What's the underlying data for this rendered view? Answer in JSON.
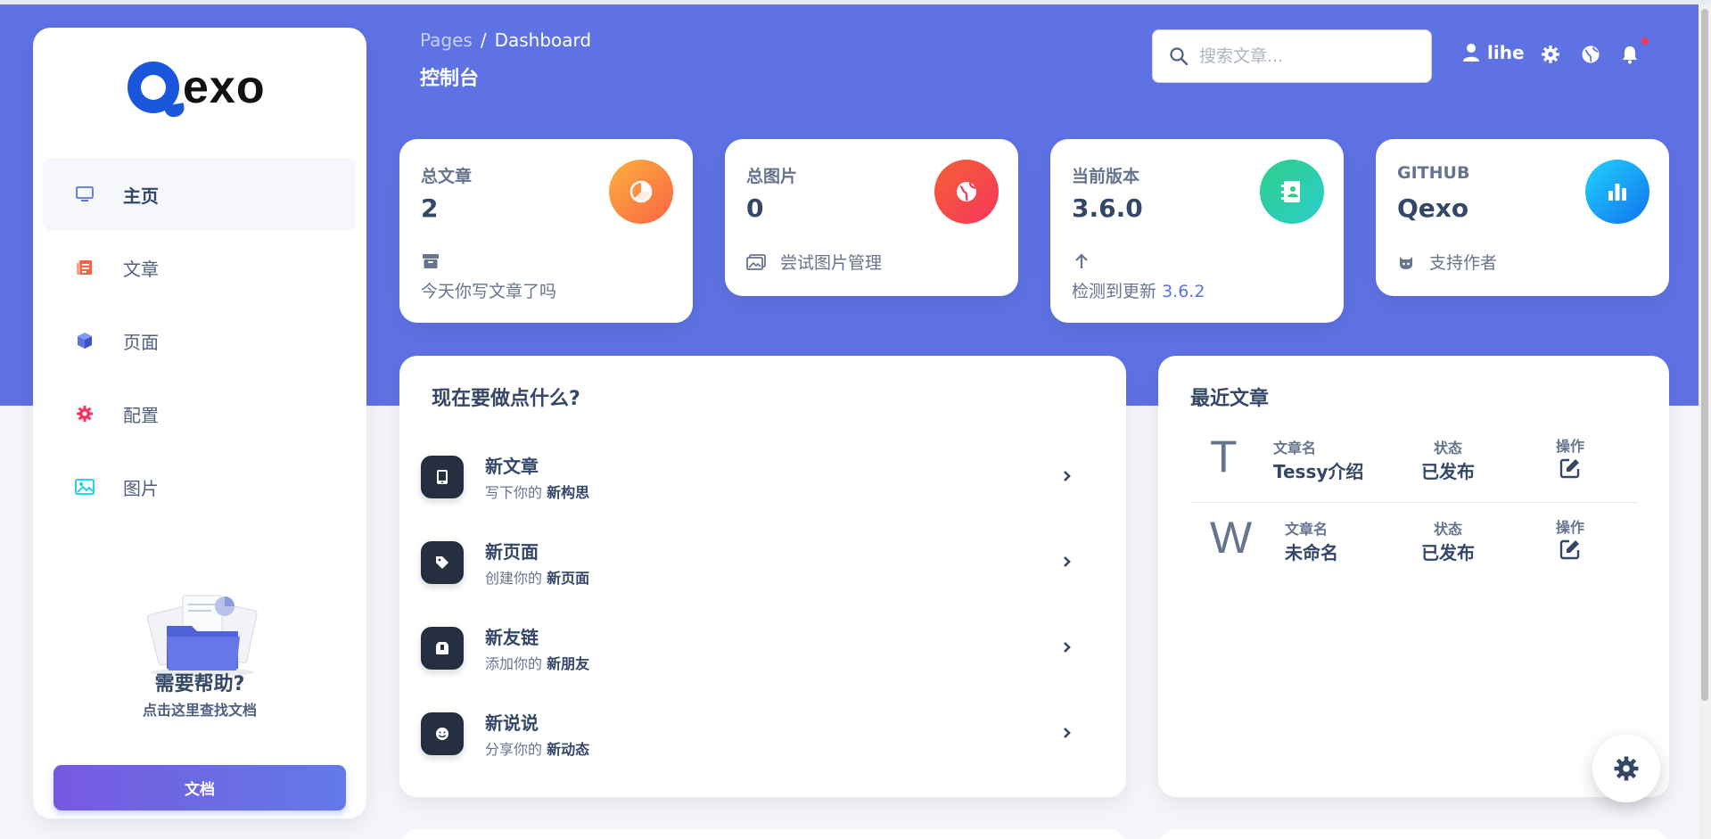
{
  "logo": {
    "text": "exo"
  },
  "sidebar": {
    "items": [
      {
        "label": "主页",
        "icon": "monitor-icon",
        "active": true
      },
      {
        "label": "文章",
        "icon": "document-icon"
      },
      {
        "label": "页面",
        "icon": "cube-icon"
      },
      {
        "label": "配置",
        "icon": "gear-icon"
      },
      {
        "label": "图片",
        "icon": "image-icon"
      }
    ],
    "help_title": "需要帮助?",
    "help_sub": "点击这里查找文档",
    "doc_button": "文档"
  },
  "header": {
    "breadcrumb_root": "Pages",
    "breadcrumb_sep": "/",
    "breadcrumb_current": "Dashboard",
    "title": "控制台",
    "search_placeholder": "搜索文章...",
    "username": "lihe"
  },
  "stats": [
    {
      "label": "总文章",
      "value": "2",
      "foot": "今天你写文章了吗",
      "color": "#fb8c39"
    },
    {
      "label": "总图片",
      "value": "0",
      "foot": "尝试图片管理",
      "color": "#f5365c"
    },
    {
      "label": "当前版本",
      "value": "3.6.0",
      "foot": "检测到更新",
      "foot_link": "3.6.2",
      "color": "#2dce89"
    },
    {
      "label": "GITHUB",
      "value": "Qexo",
      "foot": "支持作者",
      "color": "#11a6f0"
    }
  ],
  "todo": {
    "title": "现在要做点什么?",
    "items": [
      {
        "title": "新文章",
        "sub_prefix": "写下你的",
        "sub_bold": "新构思"
      },
      {
        "title": "新页面",
        "sub_prefix": "创建你的",
        "sub_bold": "新页面"
      },
      {
        "title": "新友链",
        "sub_prefix": "添加你的",
        "sub_bold": "新朋友"
      },
      {
        "title": "新说说",
        "sub_prefix": "分享你的",
        "sub_bold": "新动态"
      }
    ]
  },
  "recent": {
    "title": "最近文章",
    "col_name": "文章名",
    "col_status": "状态",
    "col_action": "操作",
    "posts": [
      {
        "initial": "T",
        "name": "Tessy介绍",
        "status": "已发布"
      },
      {
        "initial": "W",
        "name": "未命名",
        "status": "已发布"
      }
    ]
  },
  "colors": {
    "primary": "#5e72e4",
    "dark": "#344767",
    "muted": "#67748e"
  }
}
